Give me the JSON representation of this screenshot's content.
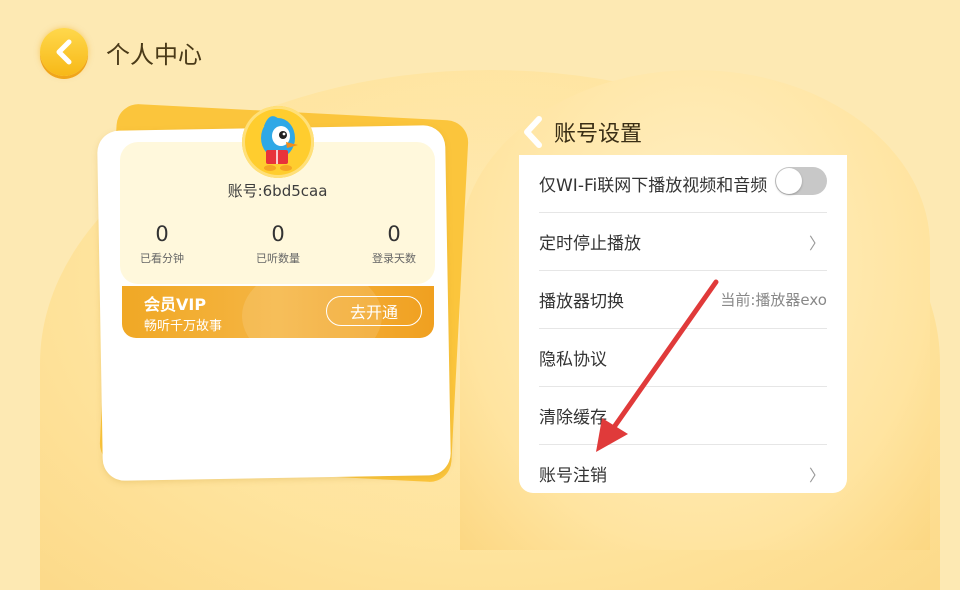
{
  "header": {
    "title": "个人中心",
    "back_icon": "chevron-left-icon"
  },
  "profile": {
    "avatar_icon": "cartoon-bird-mascot-icon",
    "account_label": "账号:6bd5caa",
    "stats": [
      {
        "value": "0",
        "label": "已看分钟"
      },
      {
        "value": "0",
        "label": "已听数量"
      },
      {
        "value": "0",
        "label": "登录天数"
      }
    ]
  },
  "vip": {
    "title": "会员VIP",
    "subtitle": "畅听千万故事",
    "button_label": "去开通"
  },
  "settings": {
    "title": "账号设置",
    "rows": [
      {
        "label": "仅WI-Fi联网下播放视频和音频",
        "control": "toggle",
        "toggle_on": false
      },
      {
        "label": "定时停止播放",
        "control": "chevron",
        "chevron": "〉"
      },
      {
        "label": "播放器切换",
        "control": "value",
        "value": "当前:播放器exo"
      },
      {
        "label": "隐私协议",
        "control": "none"
      },
      {
        "label": "清除缓存",
        "control": "none"
      },
      {
        "label": "账号注销",
        "control": "chevron",
        "chevron": "〉"
      }
    ]
  },
  "colors": {
    "accent": "#f7b817",
    "annotation_arrow": "#e03a3a",
    "background": "#fde9b3"
  }
}
